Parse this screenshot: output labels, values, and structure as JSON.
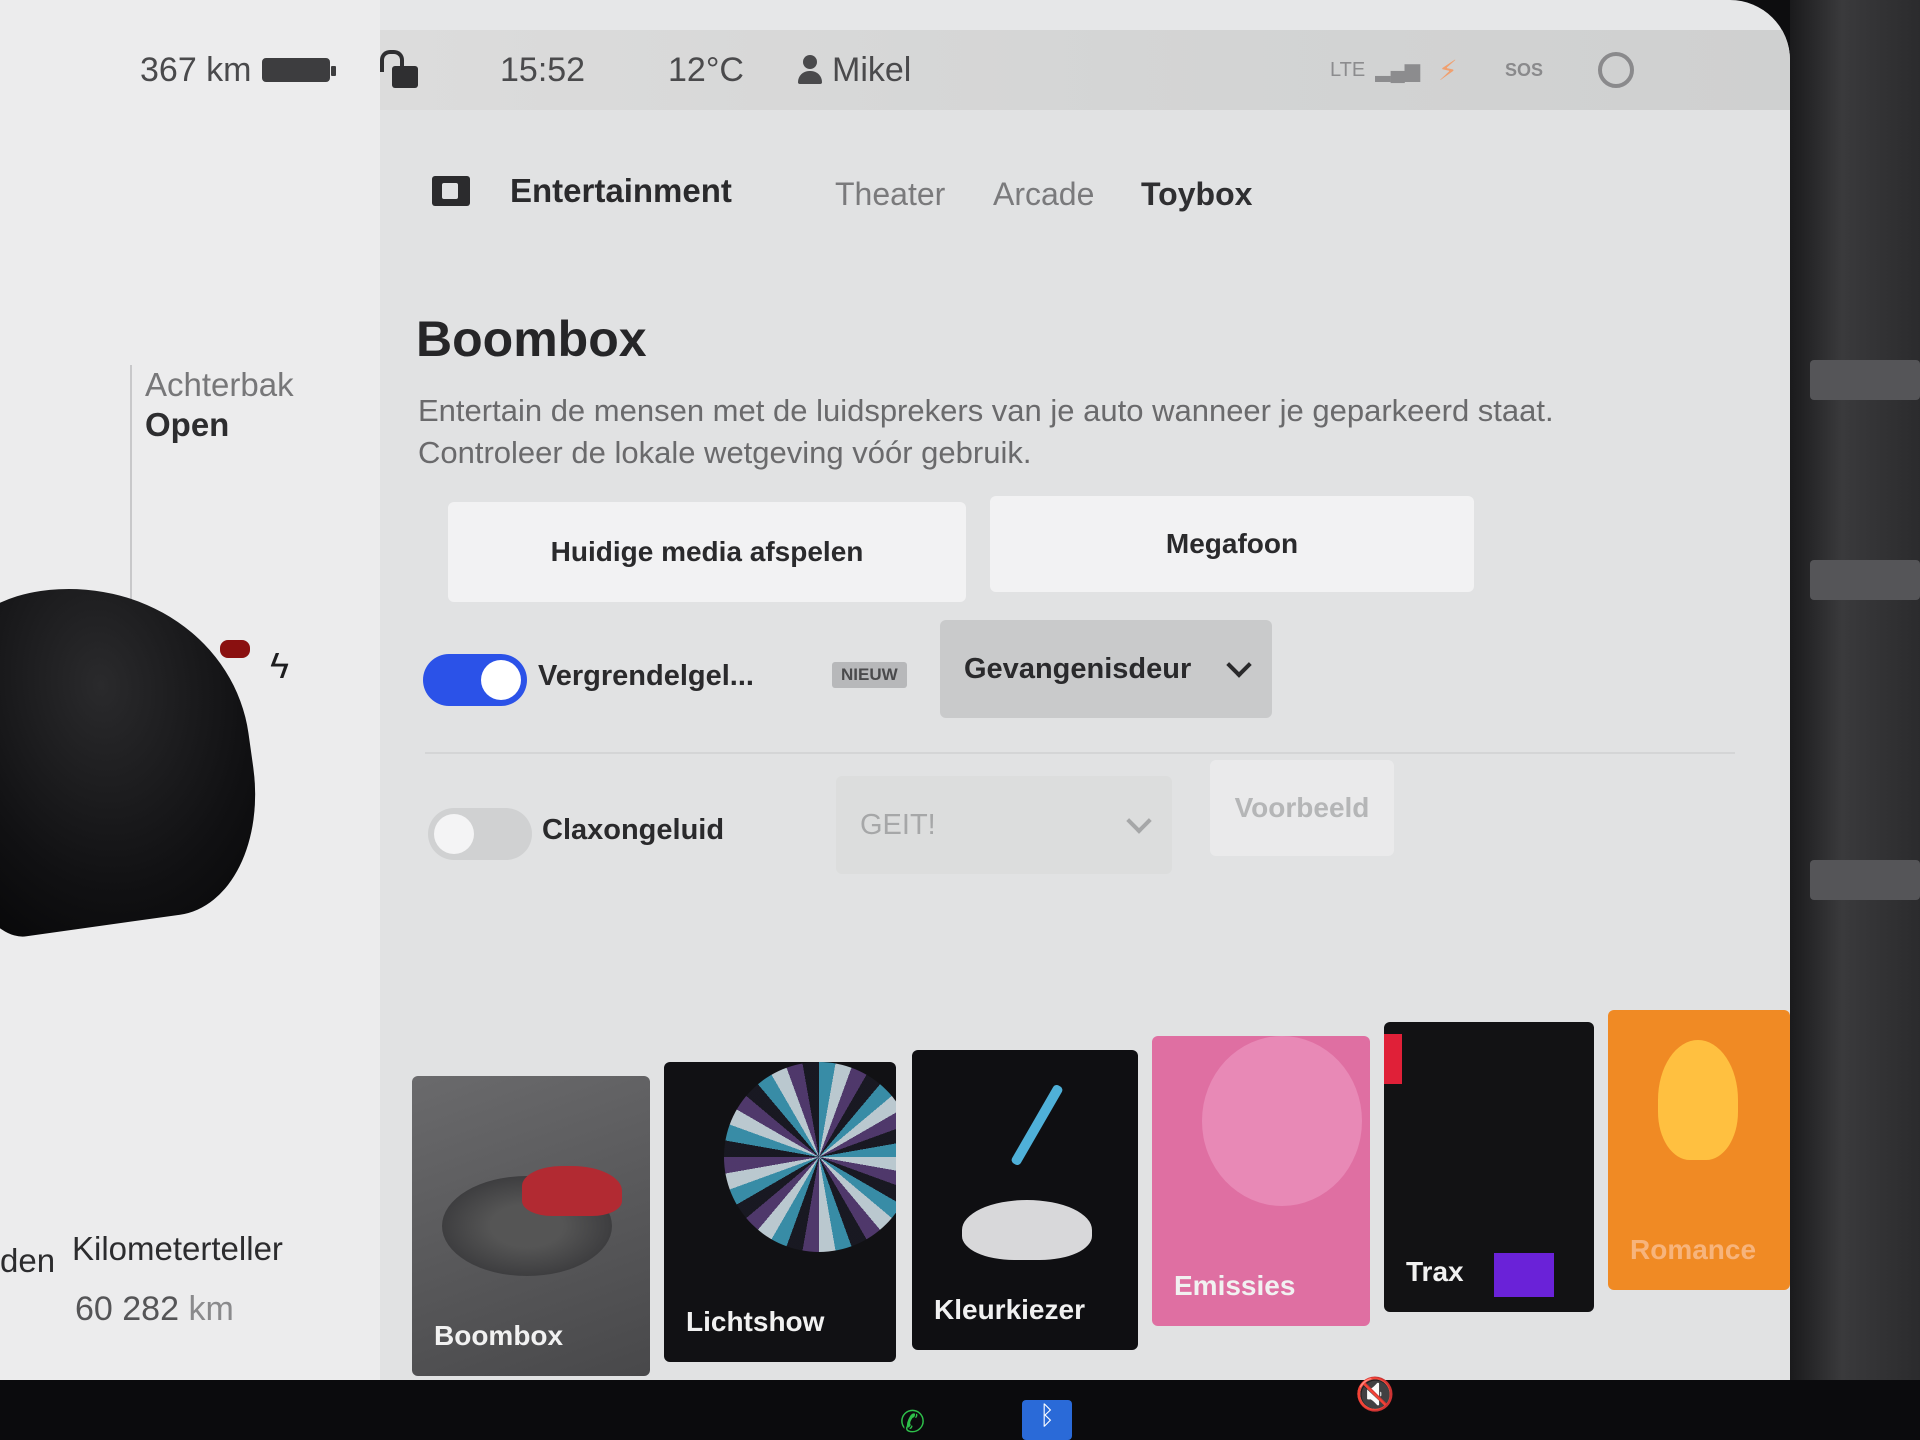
{
  "status_bar": {
    "range": "367 km",
    "time": "15:52",
    "temperature": "12°C",
    "user": "Mikel",
    "signal": "LTE",
    "sos": "SOS"
  },
  "vehicle": {
    "trunk_label": "Achterbak",
    "trunk_state": "Open",
    "odometer_label": "Kilometerteller",
    "odometer_prev_fragment": "den",
    "odometer_value": "60 282",
    "odometer_unit": "km"
  },
  "header": {
    "title": "Entertainment",
    "tabs": [
      {
        "label": "Theater",
        "active": false
      },
      {
        "label": "Arcade",
        "active": false
      },
      {
        "label": "Toybox",
        "active": true
      }
    ]
  },
  "boombox": {
    "title": "Boombox",
    "description": "Entertain de mensen met de luidsprekers van je auto wanneer je geparkeerd staat. Controleer de lokale wetgeving vóór gebruik.",
    "play_media_button": "Huidige media afspelen",
    "megaphone_button": "Megafoon",
    "lock_sound": {
      "label": "Vergrendelgel...",
      "badge": "NIEUW",
      "enabled": true,
      "selected": "Gevangenisdeur"
    },
    "horn_sound": {
      "label": "Claxongeluid",
      "enabled": false,
      "selected": "GEIT!",
      "preview_button": "Voorbeeld"
    }
  },
  "tiles": [
    {
      "label": "Boombox"
    },
    {
      "label": "Lichtshow"
    },
    {
      "label": "Kleurkiezer"
    },
    {
      "label": "Emissies"
    },
    {
      "label": "Trax"
    },
    {
      "label": "Romance"
    }
  ],
  "colors": {
    "accent": "#2b52e8",
    "screen_bg": "#e1e2e3",
    "emissies": "#df6fa2",
    "romance": "#f08a24"
  },
  "icons": {
    "battery": "battery-icon",
    "lock": "unlocked-icon",
    "user": "person-icon",
    "entertainment": "film-icon",
    "bluetooth": "bluetooth-icon",
    "phone": "phone-icon",
    "volume": "mute-icon"
  }
}
